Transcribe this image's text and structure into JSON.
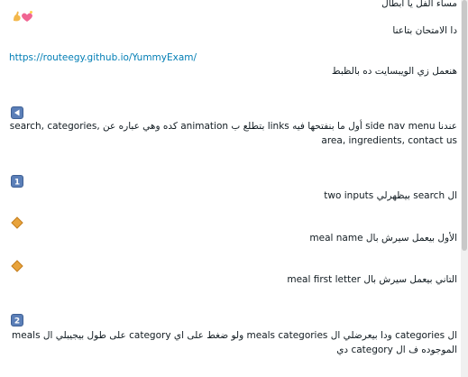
{
  "messages": {
    "greeting": "مساء الفل يا ابطال",
    "exam_line": "دا الامتحان بتاعنا",
    "exam_link": "https://routeegy.github.io/YummyExam/",
    "website_line": "هنعمل زي الويبسايت ده بالظبط",
    "nav_line": "عندنا side nav menu أول ما بنفتحها فيه links بتطلع ب animation كده وهي عباره عن search, categories, area, ingredients, contact us",
    "search_line": "ال search بيظهرلي two inputs",
    "meal_name_line": "الأول بيعمل سيرش بال meal name",
    "first_letter_line": "التاني بيعمل سيرش بال meal first letter",
    "categories_line": "ال categories ودا بيعرضلي ال meals categories ولو ضغط على اي category على طول بيجيبلي ال meals الموجوده ف ال category دي"
  },
  "icons": {
    "greeting_emoji": "heart-flexed-arm-emoji",
    "nav_bullet": "back-arrow-icon",
    "step_one": "keycap-1-icon",
    "diamond": "orange-diamond-icon",
    "step_two": "keycap-2-icon"
  },
  "colors": {
    "link": "#027eb5",
    "keycap": "#5b7fb8",
    "diamond": "#e8a33c",
    "heart": "#f06592",
    "arm": "#f3b74b"
  }
}
